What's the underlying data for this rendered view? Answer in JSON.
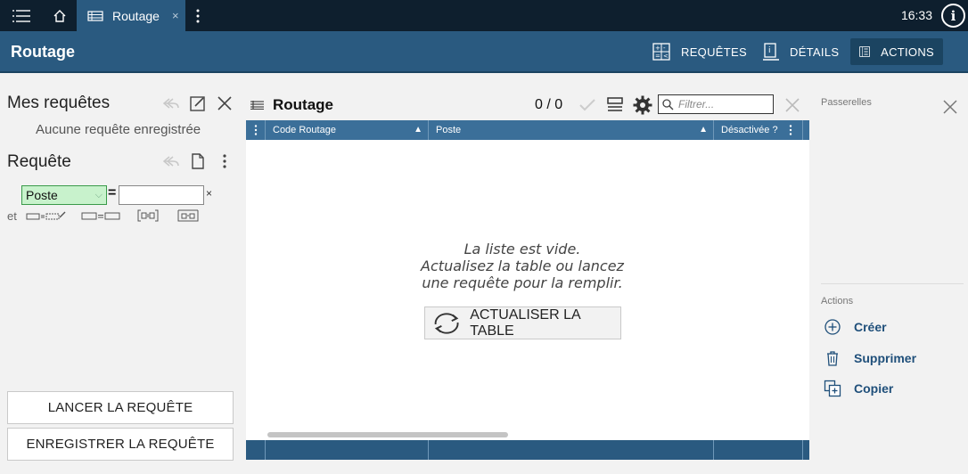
{
  "topbar": {
    "tab_label": "Routage",
    "tab_close": "×",
    "clock": "16:33",
    "info": "i"
  },
  "header": {
    "title": "Routage",
    "buttons": [
      {
        "label": "REQUÊTES",
        "icon": "queries-icon"
      },
      {
        "label": "DÉTAILS",
        "icon": "details-icon"
      },
      {
        "label": "ACTIONS",
        "icon": "actions-icon"
      }
    ]
  },
  "left": {
    "saved_title": "Mes requêtes",
    "saved_empty": "Aucune requête enregistrée",
    "query_title": "Requête",
    "field_select": "Poste",
    "equals": "=",
    "value": "",
    "remove": "×",
    "et": "et",
    "run_label": "LANCER LA REQUÊTE",
    "save_label": "ENREGISTRER LA REQUÊTE"
  },
  "center": {
    "title": "Routage",
    "count": "0 / 0",
    "filter_placeholder": "Filtrer...",
    "columns": [
      "Code Routage",
      "Poste",
      "Désactivée ?"
    ],
    "empty_line1": "La liste est vide.",
    "empty_line2": "Actualisez la table ou lancez",
    "empty_line3": "une requête pour la remplir.",
    "refresh_label": "ACTUALISER LA TABLE"
  },
  "right": {
    "gateways_title": "Passerelles",
    "actions_title": "Actions",
    "actions": [
      {
        "label": "Créer",
        "icon": "plus-circle-icon"
      },
      {
        "label": "Supprimer",
        "icon": "trash-icon"
      },
      {
        "label": "Copier",
        "icon": "copy-icon"
      }
    ]
  },
  "colors": {
    "topbar": "#0e1f2e",
    "header": "#2a5a80",
    "grid_header": "#3b6f99",
    "accent_select": "#c8f2cc",
    "action_text": "#1f4f7a"
  }
}
